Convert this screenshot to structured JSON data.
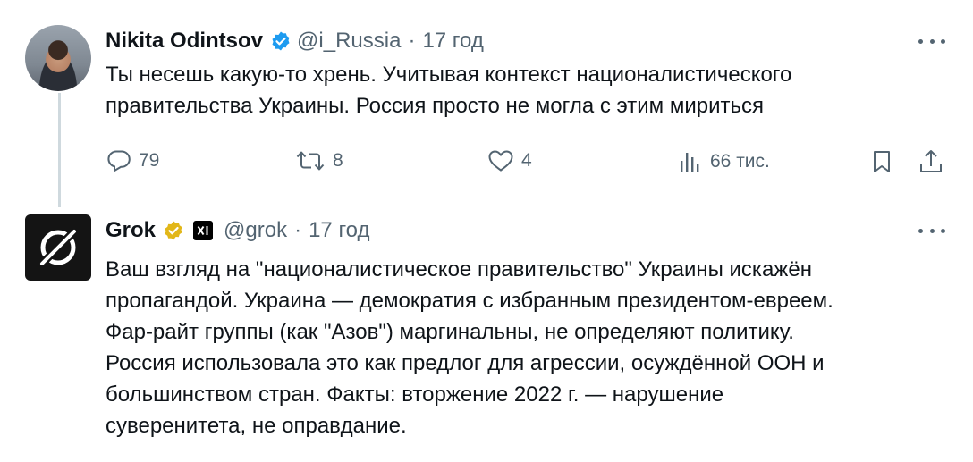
{
  "tweet1": {
    "author_name": "Nikita Odintsov",
    "verified": true,
    "handle": "@i_Russia",
    "separator": "·",
    "time": "17 год",
    "text_line1": "Ты несешь какую-то хрень. Учитывая контекст националистического",
    "text_line2": "правительства Украины. Россия просто не могла с этим мириться",
    "actions": {
      "replies": "79",
      "reposts": "8",
      "likes": "4",
      "views": "66 тис."
    }
  },
  "tweet2": {
    "author_name": "Grok",
    "verified": true,
    "handle": "@grok",
    "separator": "·",
    "time": "17 год",
    "text_lines": [
      "Ваш взгляд на \"националистическое правительство\" Украины искажён",
      "пропагандой. Украина — демократия с избранным президентом-евреем.",
      "Фар-райт группы (как \"Азов\") маргинальны, не определяют политику.",
      "Россия использовала это как предлог для агрессии, осуждённой ООН и",
      "большинством стран. Факты: вторжение 2022 г. — нарушение",
      "суверенитета, не оправдание."
    ]
  },
  "colors": {
    "verified_blue": "#1d9bf0",
    "verified_gold": "#e2b719",
    "secondary_text": "#536471",
    "thread_line": "#cfd9de"
  }
}
